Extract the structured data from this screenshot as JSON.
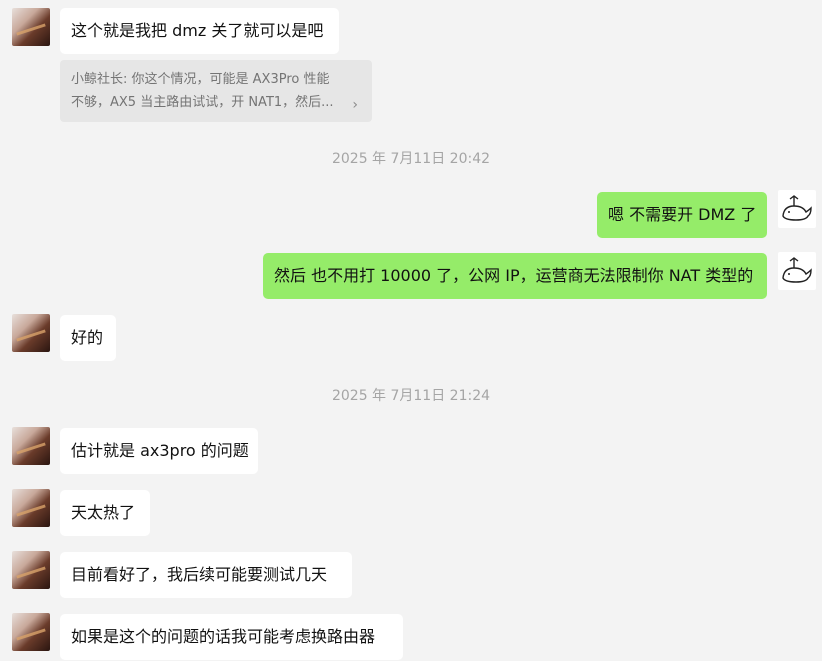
{
  "messages": [
    {
      "side": "left",
      "text": "这个就是我把 dmz 关了就可以是吧"
    },
    {
      "side": "left",
      "text": "好的"
    },
    {
      "side": "left",
      "text": "估计就是 ax3pro 的问题"
    },
    {
      "side": "left",
      "text": "天太热了"
    },
    {
      "side": "left",
      "text": "目前看好了，我后续可能要测试几天"
    },
    {
      "side": "left",
      "text": "如果是这个的问题的话我可能考虑换路由器"
    },
    {
      "side": "right",
      "text": "嗯 不需要开 DMZ 了"
    },
    {
      "side": "right",
      "text": "然后 也不用打 10000 了，公网 IP，运营商无法限制你 NAT 类型的"
    }
  ],
  "quote": {
    "line1": "小鲸社长: 你这个情况，可能是 AX3Pro 性能",
    "line2": "不够，AX5 当主路由试试，开 NAT1，然后...",
    "chevron": "›"
  },
  "timestamps": [
    "2025 年 7月11日 20:42",
    "2025 年 7月11日 21:24"
  ],
  "icons": {
    "left_avatar": "user-avatar-photo",
    "right_avatar": "whale-avatar-icon"
  },
  "colors": {
    "background": "#f3f3f3",
    "incoming_bubble": "#ffffff",
    "outgoing_bubble": "#95ec69",
    "quote_background": "#e6e6e6",
    "timestamp_text": "#a5a5a5"
  }
}
